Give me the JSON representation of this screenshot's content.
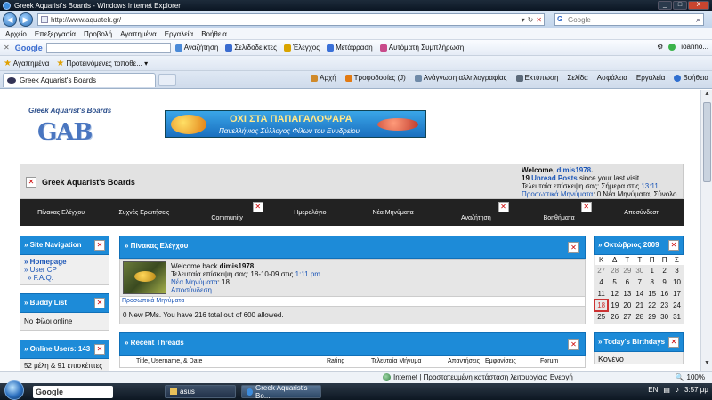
{
  "window": {
    "title": "Greek Aquarist's Boards - Windows Internet Explorer",
    "min": "_",
    "max": "□",
    "close": "X"
  },
  "address": {
    "url": "http://www.aquatek.gr/",
    "search_placeholder": "Google"
  },
  "menu": [
    "Αρχείο",
    "Επεξεργασία",
    "Προβολή",
    "Αγαπημένα",
    "Εργαλεία",
    "Βοήθεια"
  ],
  "google_toolbar": {
    "logo": "Google",
    "items": [
      "Αναζήτηση",
      "Σελιδοδείκτες",
      "Έλεγχος",
      "Μετάφραση",
      "Αυτόματη Συμπλήρωση"
    ],
    "user": "ioanno..."
  },
  "favorites": {
    "label": "Αγαπημένα",
    "suggested": "Προτεινόμενες τοποθε..."
  },
  "tab": {
    "title": "Greek Aquarist's Boards"
  },
  "command_bar": [
    "Αρχή",
    "Τροφοδοσίες (J)",
    "Ανάγνωση αλληλογραφίας",
    "Εκτύπωση",
    "Σελίδα",
    "Ασφάλεια",
    "Εργαλεία",
    "Βοήθεια"
  ],
  "site": {
    "logo_arc": "Greek Aquarist's Boards",
    "logo_text": "GAB",
    "banner_line1": "ΟΧΙ ΣΤΑ ΠΑΠΑΓΑΛΟΨΑΡΑ",
    "banner_line2": "Πανελλήνιος Σύλλογος Φίλων του Ενυδρείου",
    "title": "Greek Aquarist's Boards",
    "welcome_prefix": "Welcome,",
    "username": "dimis1978",
    "unread_count": "19",
    "unread_label": "Unread Posts",
    "unread_suffix": "since your last visit.",
    "last_visit": "Τελευταία επίσκεψη σας: Σήμερα στις",
    "last_visit_time": "13:11",
    "pm_label": "Προσωπικά Μηνύματα",
    "pm_stats": ": 0 Νέα Μηνύματα, Σύνολο 216."
  },
  "nav": [
    "Πίνακας Ελέγχου",
    "Συχνές Ερωτήσεις",
    "Community",
    "Ημερολόγιο",
    "Νέα Μηνύματα",
    "Αναζήτηση",
    "Βοηθήματα",
    "Αποσύνδεση"
  ],
  "sidebar": {
    "site_nav": {
      "title": "» Site Navigation",
      "items": [
        "» Homepage",
        "» User CP",
        "» F.A.Q."
      ]
    },
    "buddy": {
      "title": "» Buddy List",
      "body": "Νο Φίλοι online"
    },
    "online": {
      "title": "» Online Users: 143",
      "body": "52 μέλη & 91 επισκέπτες"
    }
  },
  "usercp": {
    "title": "» Πίνακας Ελέγχου",
    "welcome_back": "Welcome back",
    "username": "dimis1978",
    "last_visit": "Τελευταία επίσκεψη σας: 18-10-09 στις",
    "last_visit_time": "1:11 pm",
    "new_posts_label": "Νέα Μηνύματα",
    "new_posts_count": ": 18",
    "logout": "Αποσύνδεση",
    "pm_tab": "Προσωπικά Μηνύματα",
    "pm_body": "0 New PMs. You have 216 total out of 600 allowed."
  },
  "recent_threads": {
    "title": "» Recent Threads",
    "columns": [
      "Title, Username, & Date",
      "Rating",
      "Τελευταία Μήνυμα",
      "Απαντήσεις",
      "Εμφανίσεις",
      "Forum"
    ]
  },
  "calendar": {
    "title": "» Οκτώβριος 2009",
    "dow": [
      "Κ",
      "Δ",
      "Τ",
      "Τ",
      "Π",
      "Π",
      "Σ"
    ],
    "weeks": [
      [
        "27",
        "28",
        "29",
        "30",
        "1",
        "2",
        "3"
      ],
      [
        "4",
        "5",
        "6",
        "7",
        "8",
        "9",
        "10"
      ],
      [
        "11",
        "12",
        "13",
        "14",
        "15",
        "16",
        "17"
      ],
      [
        "18",
        "19",
        "20",
        "21",
        "22",
        "23",
        "24"
      ],
      [
        "25",
        "26",
        "27",
        "28",
        "29",
        "30",
        "31"
      ]
    ],
    "today": "18"
  },
  "birthdays": {
    "title": "» Today's Birthdays",
    "first": "Κονένο"
  },
  "status": {
    "zone": "Internet | Προστατευμένη κατάσταση λειτουργίας: Ενεργή",
    "zoom": "100%"
  },
  "taskbar": {
    "google": "Google",
    "items": [
      "asus",
      "Greek Aquarist's Bo..."
    ],
    "lang": "EN",
    "time": "3:57 μμ"
  }
}
